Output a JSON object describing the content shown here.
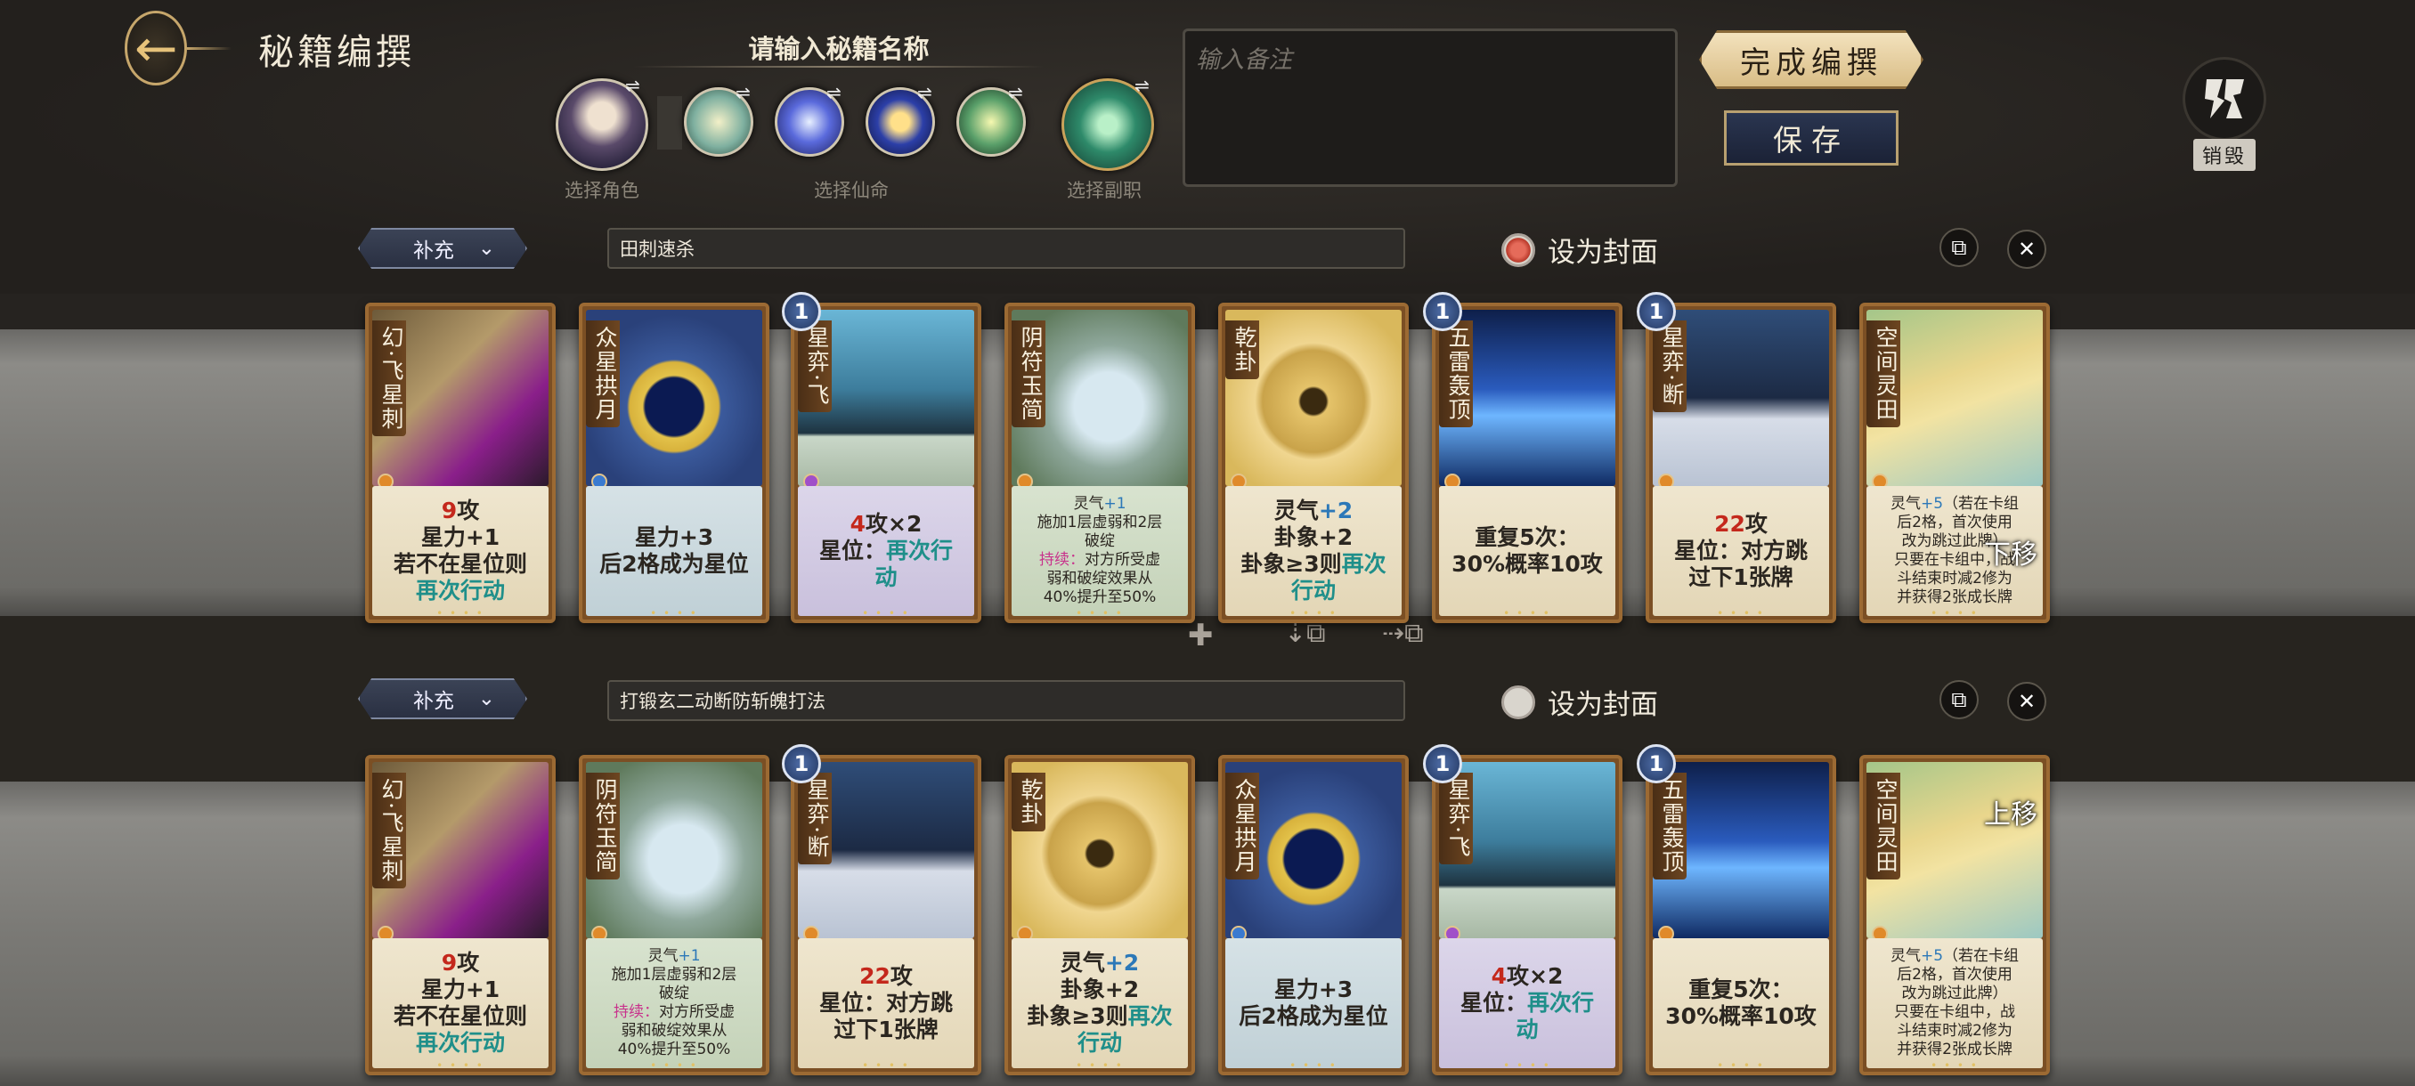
{
  "header": {
    "title": "秘籍编撰",
    "name_prompt": "请输入秘籍名称",
    "note_placeholder": "输入备注",
    "finish_label": "完成编撰",
    "save_label": "保存",
    "destroy_label": "销毁",
    "slot_labels": {
      "character": "选择角色",
      "fate": "选择仙命",
      "subjob": "选择副职"
    }
  },
  "decks": [
    {
      "type_label": "补充",
      "name": "田刺速杀",
      "cover_label": "设为封面",
      "is_cover": true,
      "cards": [
        {
          "name": "幻·飞星刺",
          "lines": [
            [
              {
                "t": "9",
                "c": "red"
              },
              {
                "t": "攻"
              }
            ],
            [
              {
                "t": "星力+1"
              }
            ],
            [
              {
                "t": "若不在星位则"
              }
            ],
            [
              {
                "t": "再次行动",
                "c": "teal"
              }
            ]
          ],
          "style": "",
          "small": false,
          "cost": ""
        },
        {
          "name": "众星拱月",
          "lines": [
            [
              {
                "t": "星力+3"
              }
            ],
            [
              {
                "t": "后2格成为星位"
              }
            ]
          ],
          "style": "blue",
          "small": false,
          "cost": ""
        },
        {
          "name": "星弈·飞",
          "lines": [
            [
              {
                "t": "4",
                "c": "red"
              },
              {
                "t": "攻×2"
              }
            ],
            [
              {
                "t": "星位："
              },
              {
                "t": "再次行",
                "c": "teal"
              }
            ],
            [
              {
                "t": "动",
                "c": "teal"
              }
            ]
          ],
          "style": "purple",
          "small": false,
          "cost": "1"
        },
        {
          "name": "阴符玉简",
          "lines": [
            [
              {
                "t": "灵气"
              },
              {
                "t": "+1",
                "c": "blue"
              }
            ],
            [
              {
                "t": "施加1层虚弱和2层"
              }
            ],
            [
              {
                "t": "破绽"
              }
            ],
            [
              {
                "t": "持续：",
                "c": "pink"
              },
              {
                "t": "对方所受虚"
              }
            ],
            [
              {
                "t": "弱和破绽效果从"
              }
            ],
            [
              {
                "t": "40%提升至50%"
              }
            ]
          ],
          "style": "green",
          "small": true,
          "cost": ""
        },
        {
          "name": "乾卦",
          "lines": [
            [
              {
                "t": "灵气"
              },
              {
                "t": "+2",
                "c": "blue"
              }
            ],
            [
              {
                "t": "卦象+2"
              }
            ],
            [
              {
                "t": "卦象≥3则"
              },
              {
                "t": "再次",
                "c": "teal"
              }
            ],
            [
              {
                "t": "行动",
                "c": "teal"
              }
            ]
          ],
          "style": "",
          "small": false,
          "cost": ""
        },
        {
          "name": "五雷轰顶",
          "lines": [
            [
              {
                "t": "重复5次："
              }
            ],
            [
              {
                "t": "30%概率10攻"
              }
            ]
          ],
          "style": "",
          "small": false,
          "cost": "1"
        },
        {
          "name": "星弈·断",
          "lines": [
            [
              {
                "t": "22",
                "c": "red"
              },
              {
                "t": "攻"
              }
            ],
            [
              {
                "t": "星位：对方跳"
              }
            ],
            [
              {
                "t": "过下1张牌"
              }
            ]
          ],
          "style": "",
          "small": false,
          "cost": "1"
        },
        {
          "name": "空间灵田",
          "lines": [
            [
              {
                "t": "灵气"
              },
              {
                "t": "+5",
                "c": "blue"
              },
              {
                "t": "（若在卡组"
              }
            ],
            [
              {
                "t": "后2格，首次使用"
              }
            ],
            [
              {
                "t": "改为跳过此牌）"
              }
            ],
            [
              {
                "t": "只要在卡组中，战"
              }
            ],
            [
              {
                "t": "斗结束时减2修为"
              }
            ],
            [
              {
                "t": "并获得2张成长牌"
              }
            ]
          ],
          "style": "",
          "small": true,
          "cost": "",
          "hint": "下移"
        }
      ]
    },
    {
      "type_label": "补充",
      "name": "打锻玄二动断防斩魄打法",
      "cover_label": "设为封面",
      "is_cover": false,
      "cards": [
        {
          "name": "幻·飞星刺",
          "lines": [
            [
              {
                "t": "9",
                "c": "red"
              },
              {
                "t": "攻"
              }
            ],
            [
              {
                "t": "星力+1"
              }
            ],
            [
              {
                "t": "若不在星位则"
              }
            ],
            [
              {
                "t": "再次行动",
                "c": "teal"
              }
            ]
          ],
          "style": "",
          "small": false,
          "cost": ""
        },
        {
          "name": "阴符玉简",
          "lines": [
            [
              {
                "t": "灵气"
              },
              {
                "t": "+1",
                "c": "blue"
              }
            ],
            [
              {
                "t": "施加1层虚弱和2层"
              }
            ],
            [
              {
                "t": "破绽"
              }
            ],
            [
              {
                "t": "持续：",
                "c": "pink"
              },
              {
                "t": "对方所受虚"
              }
            ],
            [
              {
                "t": "弱和破绽效果从"
              }
            ],
            [
              {
                "t": "40%提升至50%"
              }
            ]
          ],
          "style": "green",
          "small": true,
          "cost": ""
        },
        {
          "name": "星弈·断",
          "lines": [
            [
              {
                "t": "22",
                "c": "red"
              },
              {
                "t": "攻"
              }
            ],
            [
              {
                "t": "星位：对方跳"
              }
            ],
            [
              {
                "t": "过下1张牌"
              }
            ]
          ],
          "style": "",
          "small": false,
          "cost": "1"
        },
        {
          "name": "乾卦",
          "lines": [
            [
              {
                "t": "灵气"
              },
              {
                "t": "+2",
                "c": "blue"
              }
            ],
            [
              {
                "t": "卦象+2"
              }
            ],
            [
              {
                "t": "卦象≥3则"
              },
              {
                "t": "再次",
                "c": "teal"
              }
            ],
            [
              {
                "t": "行动",
                "c": "teal"
              }
            ]
          ],
          "style": "",
          "small": false,
          "cost": ""
        },
        {
          "name": "众星拱月",
          "lines": [
            [
              {
                "t": "星力+3"
              }
            ],
            [
              {
                "t": "后2格成为星位"
              }
            ]
          ],
          "style": "blue",
          "small": false,
          "cost": ""
        },
        {
          "name": "星弈·飞",
          "lines": [
            [
              {
                "t": "4",
                "c": "red"
              },
              {
                "t": "攻×2"
              }
            ],
            [
              {
                "t": "星位："
              },
              {
                "t": "再次行",
                "c": "teal"
              }
            ],
            [
              {
                "t": "动",
                "c": "teal"
              }
            ]
          ],
          "style": "purple",
          "small": false,
          "cost": "1"
        },
        {
          "name": "五雷轰顶",
          "lines": [
            [
              {
                "t": "重复5次："
              }
            ],
            [
              {
                "t": "30%概率10攻"
              }
            ]
          ],
          "style": "",
          "small": false,
          "cost": "1"
        },
        {
          "name": "空间灵田",
          "lines": [
            [
              {
                "t": "灵气"
              },
              {
                "t": "+5",
                "c": "blue"
              },
              {
                "t": "（若在卡组"
              }
            ],
            [
              {
                "t": "后2格，首次使用"
              }
            ],
            [
              {
                "t": "改为跳过此牌）"
              }
            ],
            [
              {
                "t": "只要在卡组中，战"
              }
            ],
            [
              {
                "t": "斗结束时减2修为"
              }
            ],
            [
              {
                "t": "并获得2张成长牌"
              }
            ]
          ],
          "style": "",
          "small": true,
          "cost": "",
          "hint": "上移"
        }
      ]
    }
  ],
  "colors": {
    "red": "#c4281c",
    "teal": "#1f8f8a",
    "blue": "#2c78b8",
    "pink": "#c8328c"
  },
  "card_art": {
    "幻·飞星刺": "linear-gradient(135deg,#6d5a3a,#b49a6a 40%,#8a1f8a 70%,#2b1a2b)",
    "众星拱月": "radial-gradient(circle at 50% 55%,#0b1a52 22%,#e3c24a 24%,#d8b23c 34%,#3b5a9c 36%,#2a417a 70%)",
    "星弈·飞": "linear-gradient(#6ab6d6,#3d7d9c 45%,#1e3340 70%,#c9d7c8 72%,#a7b8a4)",
    "阴符玉简": "radial-gradient(circle at 55% 55%,#d7e8f0 25%,#8fa89c 45%,#5f7a5c 80%)",
    "乾卦": "radial-gradient(circle at 50% 52%,#3a2a10 10%,#e5c36a 12%,#c9a34a 40%,#f0d690 46%,#d9b85c 80%)",
    "五雷轰顶": "linear-gradient(#0e1f4a,#2a5bbd 45%,#6eb6ff 60%,#0f2a62)",
    "星弈·断": "linear-gradient(#2f4d78,#1c2a44 50%,#d7dde8 62%,#b9c3d3)",
    "空间灵田": "linear-gradient(160deg,#a4c68a,#e9d68c 40%,#f2e3a2 55%,#9cc8c2)"
  }
}
